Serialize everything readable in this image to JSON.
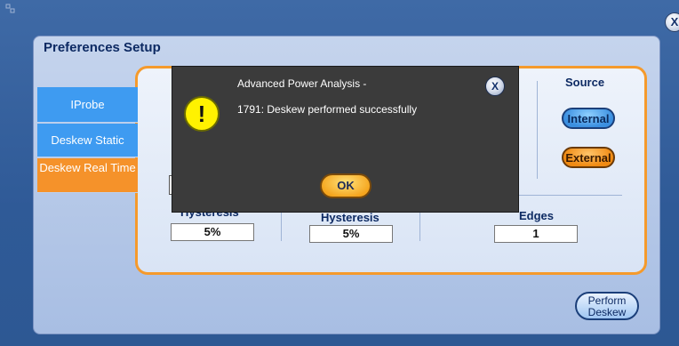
{
  "window": {
    "title": "Preferences Setup",
    "close_label": "X"
  },
  "tabs": [
    {
      "label": "IProbe"
    },
    {
      "label": "Deskew Static"
    },
    {
      "label": "Deskew Real Time"
    }
  ],
  "fields": {
    "hysteresis1": {
      "label": "Hysteresis",
      "value": "5%"
    },
    "hysteresis2": {
      "label": "Hysteresis",
      "value": "5%"
    },
    "edges": {
      "label": "Edges",
      "value": "1"
    }
  },
  "source": {
    "label": "Source",
    "internal": "Internal",
    "external": "External"
  },
  "perform_button": "Perform Deskew",
  "dialog": {
    "title": "Advanced Power Analysis -",
    "message": "1791: Deskew performed successfully",
    "close_label": "X",
    "ok_label": "OK",
    "icon_glyph": "!"
  },
  "colors": {
    "accent_orange": "#f5922a",
    "tab_blue": "#3e9bf1",
    "dialog_bg": "#3b3b3b"
  }
}
